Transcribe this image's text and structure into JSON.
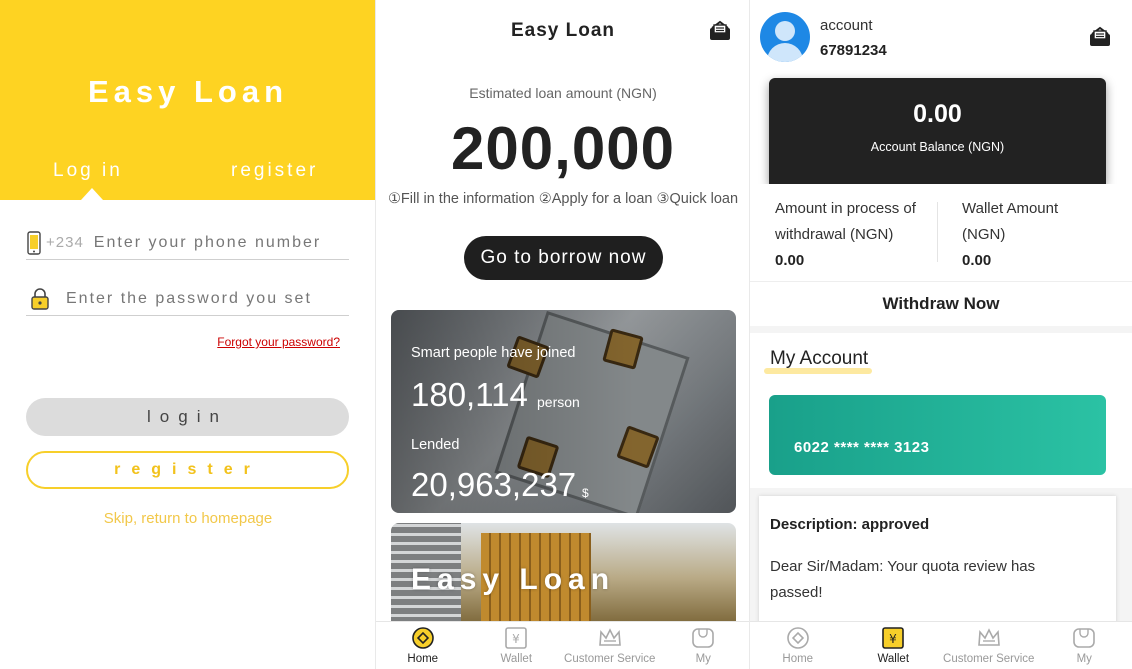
{
  "login": {
    "title": "Easy Loan",
    "tab_login": "Log in",
    "tab_register": "register",
    "phone_prefix": "+234",
    "phone_placeholder": "Enter your phone number",
    "password_placeholder": "Enter the password you set",
    "forgot": "Forgot your password?",
    "login_button": "login",
    "register_button": "register",
    "skip": "Skip, return to homepage",
    "brand_color": "#fed322"
  },
  "home": {
    "title": "Easy Loan",
    "estimated_label": "Estimated loan amount (NGN)",
    "amount": "200,000",
    "steps": "①Fill in the information ②Apply for a loan ③Quick loan",
    "borrow_button": "Go to borrow now",
    "banner1": {
      "joined_label": "Smart people have joined",
      "joined_count": "180,114",
      "person_unit": "person",
      "lended_label": "Lended",
      "lended_amount": "20,963,237",
      "currency": "$"
    },
    "banner2_text": "Easy Loan",
    "tabbar": [
      {
        "label": "Home",
        "icon": "home-icon",
        "active": true
      },
      {
        "label": "Wallet",
        "icon": "wallet-icon",
        "active": false
      },
      {
        "label": "Customer Service",
        "icon": "crown-icon",
        "active": false
      },
      {
        "label": "My",
        "icon": "my-icon",
        "active": false
      }
    ]
  },
  "wallet": {
    "account_label": "account",
    "account_number": "67891234",
    "balance": "0.00",
    "balance_label": "Account Balance (NGN)",
    "withdrawal_label": "Amount in process of withdrawal (NGN)",
    "withdrawal_value": "0.00",
    "wallet_amount_label": "Wallet Amount (NGN)",
    "wallet_amount_value": "0.00",
    "withdraw_button": "Withdraw Now",
    "my_account_title": "My Account",
    "card_number": "6022 **** **** 3123",
    "description_title": "Description: approved",
    "description_body": "Dear Sir/Madam: Your quota review has passed!",
    "tabbar": [
      {
        "label": "Home",
        "icon": "home-icon",
        "active": false
      },
      {
        "label": "Wallet",
        "icon": "wallet-icon",
        "active": true
      },
      {
        "label": "Customer Service",
        "icon": "crown-icon",
        "active": false
      },
      {
        "label": "My",
        "icon": "my-icon",
        "active": false
      }
    ]
  }
}
